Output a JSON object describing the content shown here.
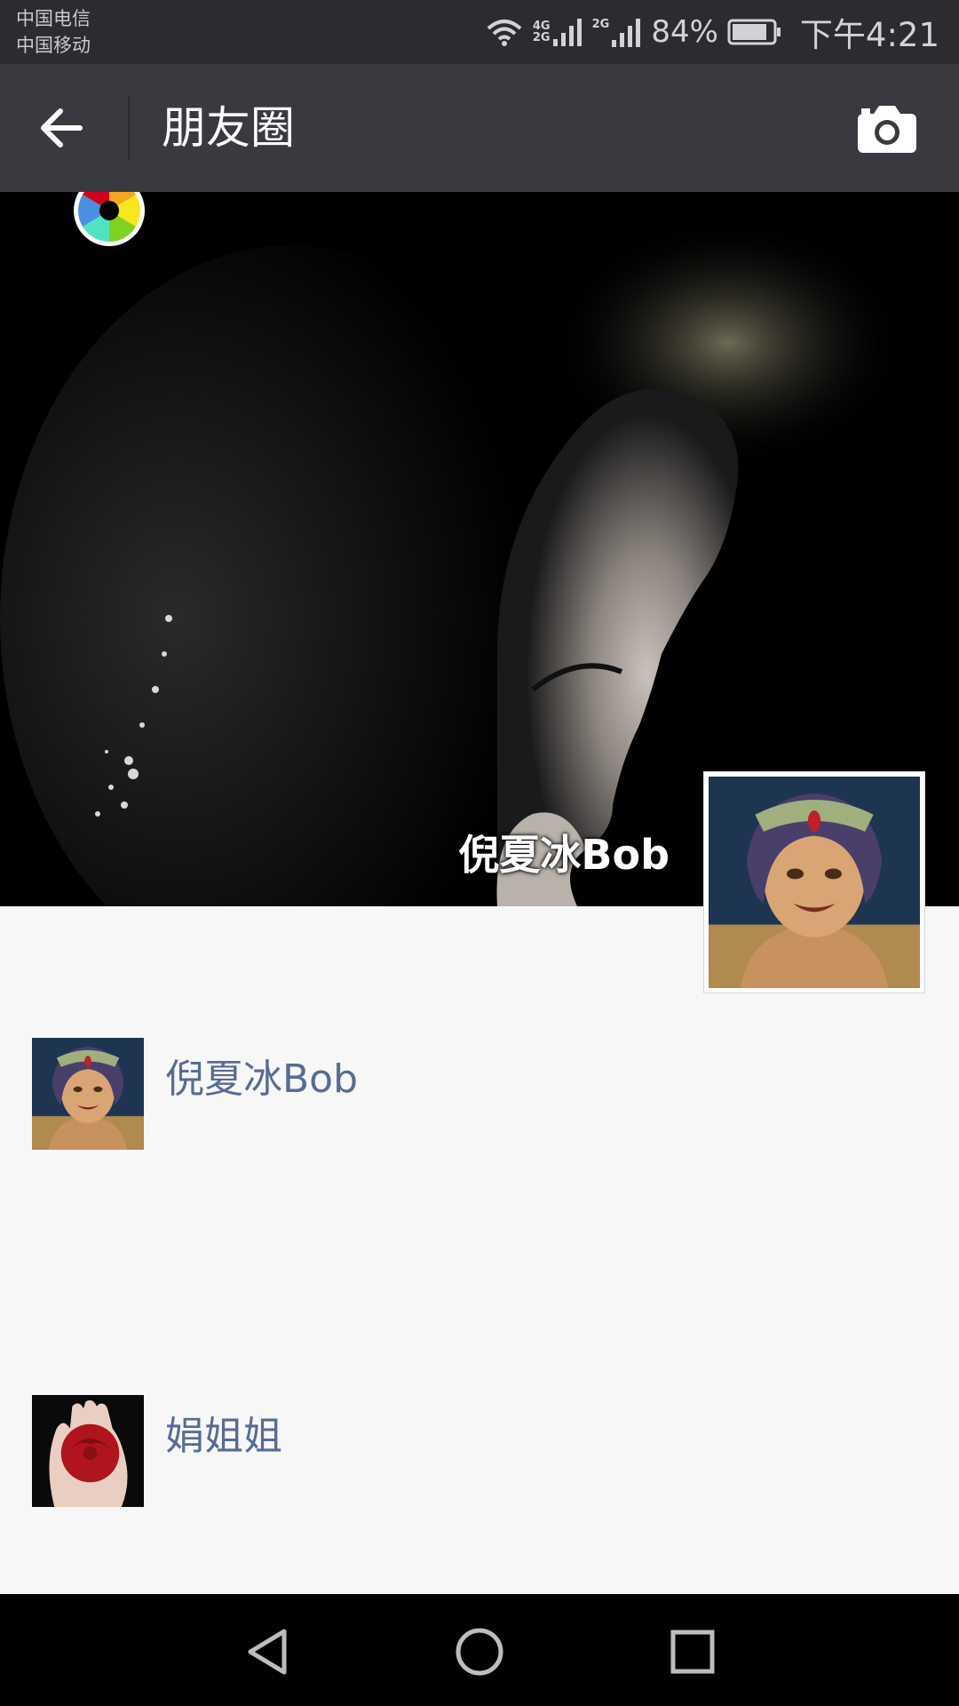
{
  "status_bar": {
    "carrier_1": "中国电信",
    "carrier_2": "中国移动",
    "signal_1_label_top": "4G",
    "signal_1_label_bottom": "2G",
    "signal_2_label": "2G",
    "battery_percent": "84%",
    "time": "下午4:21"
  },
  "nav": {
    "title": "朋友圈",
    "back_icon": "arrow-left-icon",
    "camera_icon": "camera-icon"
  },
  "cover": {
    "user_name": "倪夏冰Bob"
  },
  "feed": [
    {
      "name": "倪夏冰Bob",
      "avatar": "anime-avatar"
    },
    {
      "name": "娟姐姐",
      "avatar": "rose-avatar"
    }
  ],
  "system_nav": {
    "back": "triangle-back-icon",
    "home": "circle-home-icon",
    "recents": "square-recents-icon"
  },
  "colors": {
    "status_bar_bg": "#2b2c31",
    "nav_bar_bg": "#393a3f",
    "name_link": "#576b95",
    "page_bg": "#f7f7f7"
  }
}
